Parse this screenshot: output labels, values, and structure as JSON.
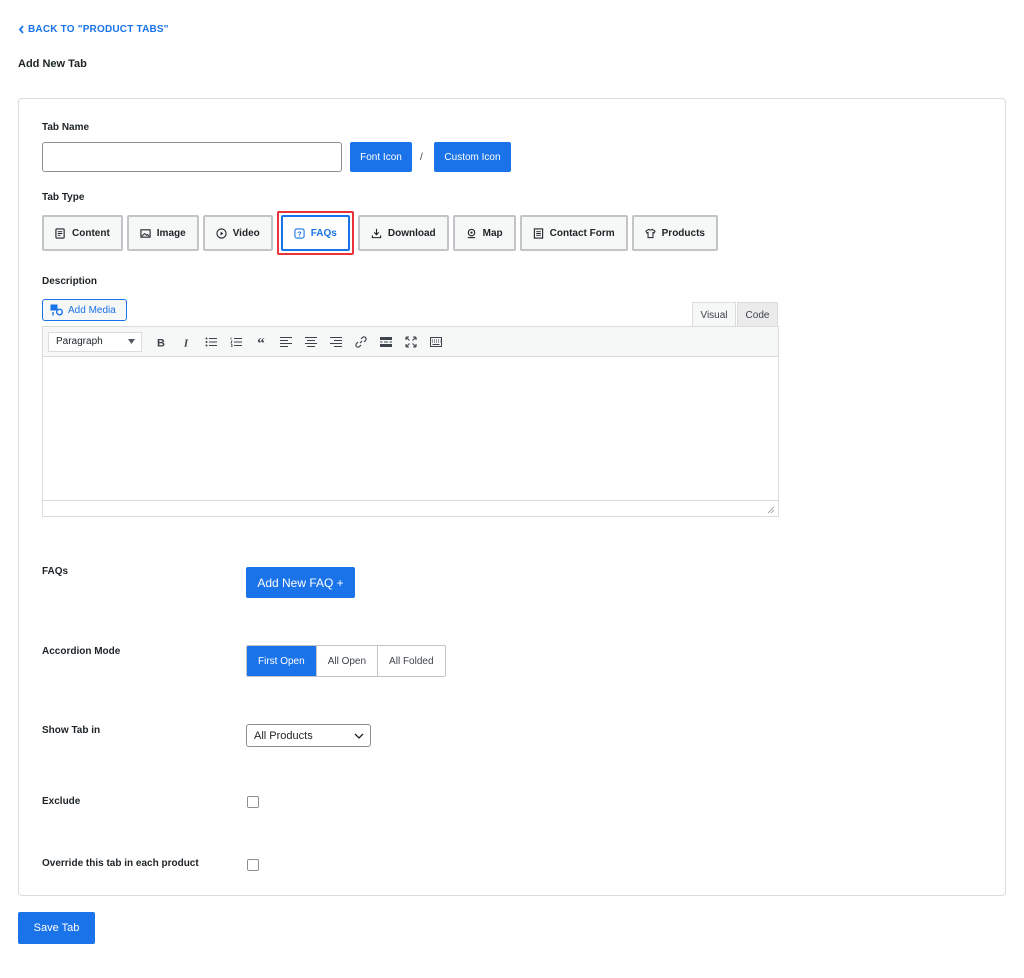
{
  "nav": {
    "back_label": "BACK TO \"PRODUCT TABS\""
  },
  "page": {
    "title": "Add New Tab"
  },
  "form": {
    "tab_name": {
      "label": "Tab Name",
      "value": "",
      "placeholder": ""
    },
    "font_icon_label": "Font Icon",
    "separator": "/",
    "custom_icon_label": "Custom Icon",
    "tab_type": {
      "label": "Tab Type",
      "options": [
        {
          "label": "Content",
          "icon": "content-icon"
        },
        {
          "label": "Image",
          "icon": "image-icon"
        },
        {
          "label": "Video",
          "icon": "video-icon"
        },
        {
          "label": "FAQs",
          "icon": "question-icon",
          "selected": true
        },
        {
          "label": "Download",
          "icon": "download-icon"
        },
        {
          "label": "Map",
          "icon": "map-pin-icon"
        },
        {
          "label": "Contact Form",
          "icon": "form-icon"
        },
        {
          "label": "Products",
          "icon": "shirt-icon"
        }
      ]
    },
    "description": {
      "label": "Description",
      "add_media_label": "Add Media",
      "tabs": {
        "visual": "Visual",
        "code": "Code",
        "active": "Visual"
      },
      "format_select": "Paragraph",
      "toolbar": [
        "bold-icon",
        "italic-icon",
        "bullet-list-icon",
        "numbered-list-icon",
        "blockquote-icon",
        "align-left-icon",
        "align-center-icon",
        "align-right-icon",
        "link-icon",
        "read-more-icon",
        "fullscreen-icon",
        "toolbar-toggle-icon"
      ],
      "content": ""
    },
    "faqs": {
      "label": "FAQs",
      "add_button_label": "Add New FAQ +"
    },
    "accordion_mode": {
      "label": "Accordion Mode",
      "options": [
        "First Open",
        "All Open",
        "All Folded"
      ],
      "selected": "First Open"
    },
    "show_tab_in": {
      "label": "Show Tab in",
      "value": "All Products"
    },
    "exclude": {
      "label": "Exclude",
      "checked": false
    },
    "override": {
      "label": "Override this tab in each product",
      "checked": false
    }
  },
  "actions": {
    "save_label": "Save Tab"
  },
  "colors": {
    "accent": "#1a73e8",
    "highlight": "#e8323c",
    "border": "#dcdcde"
  }
}
